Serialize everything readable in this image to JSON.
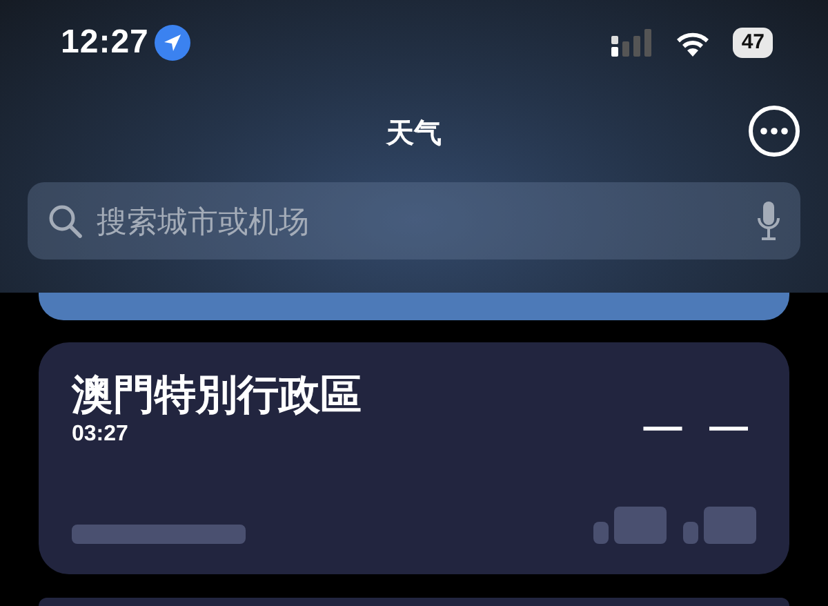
{
  "status_bar": {
    "time": "12:27",
    "battery": "47",
    "location_active": true
  },
  "header": {
    "title": "天气"
  },
  "search": {
    "placeholder": "搜索城市或机场"
  },
  "cities": [
    {
      "kind": "partial"
    },
    {
      "kind": "loading",
      "name": "澳門特別行政區",
      "time": "03:27",
      "temperature": "— —"
    },
    {
      "kind": "edge"
    }
  ]
}
